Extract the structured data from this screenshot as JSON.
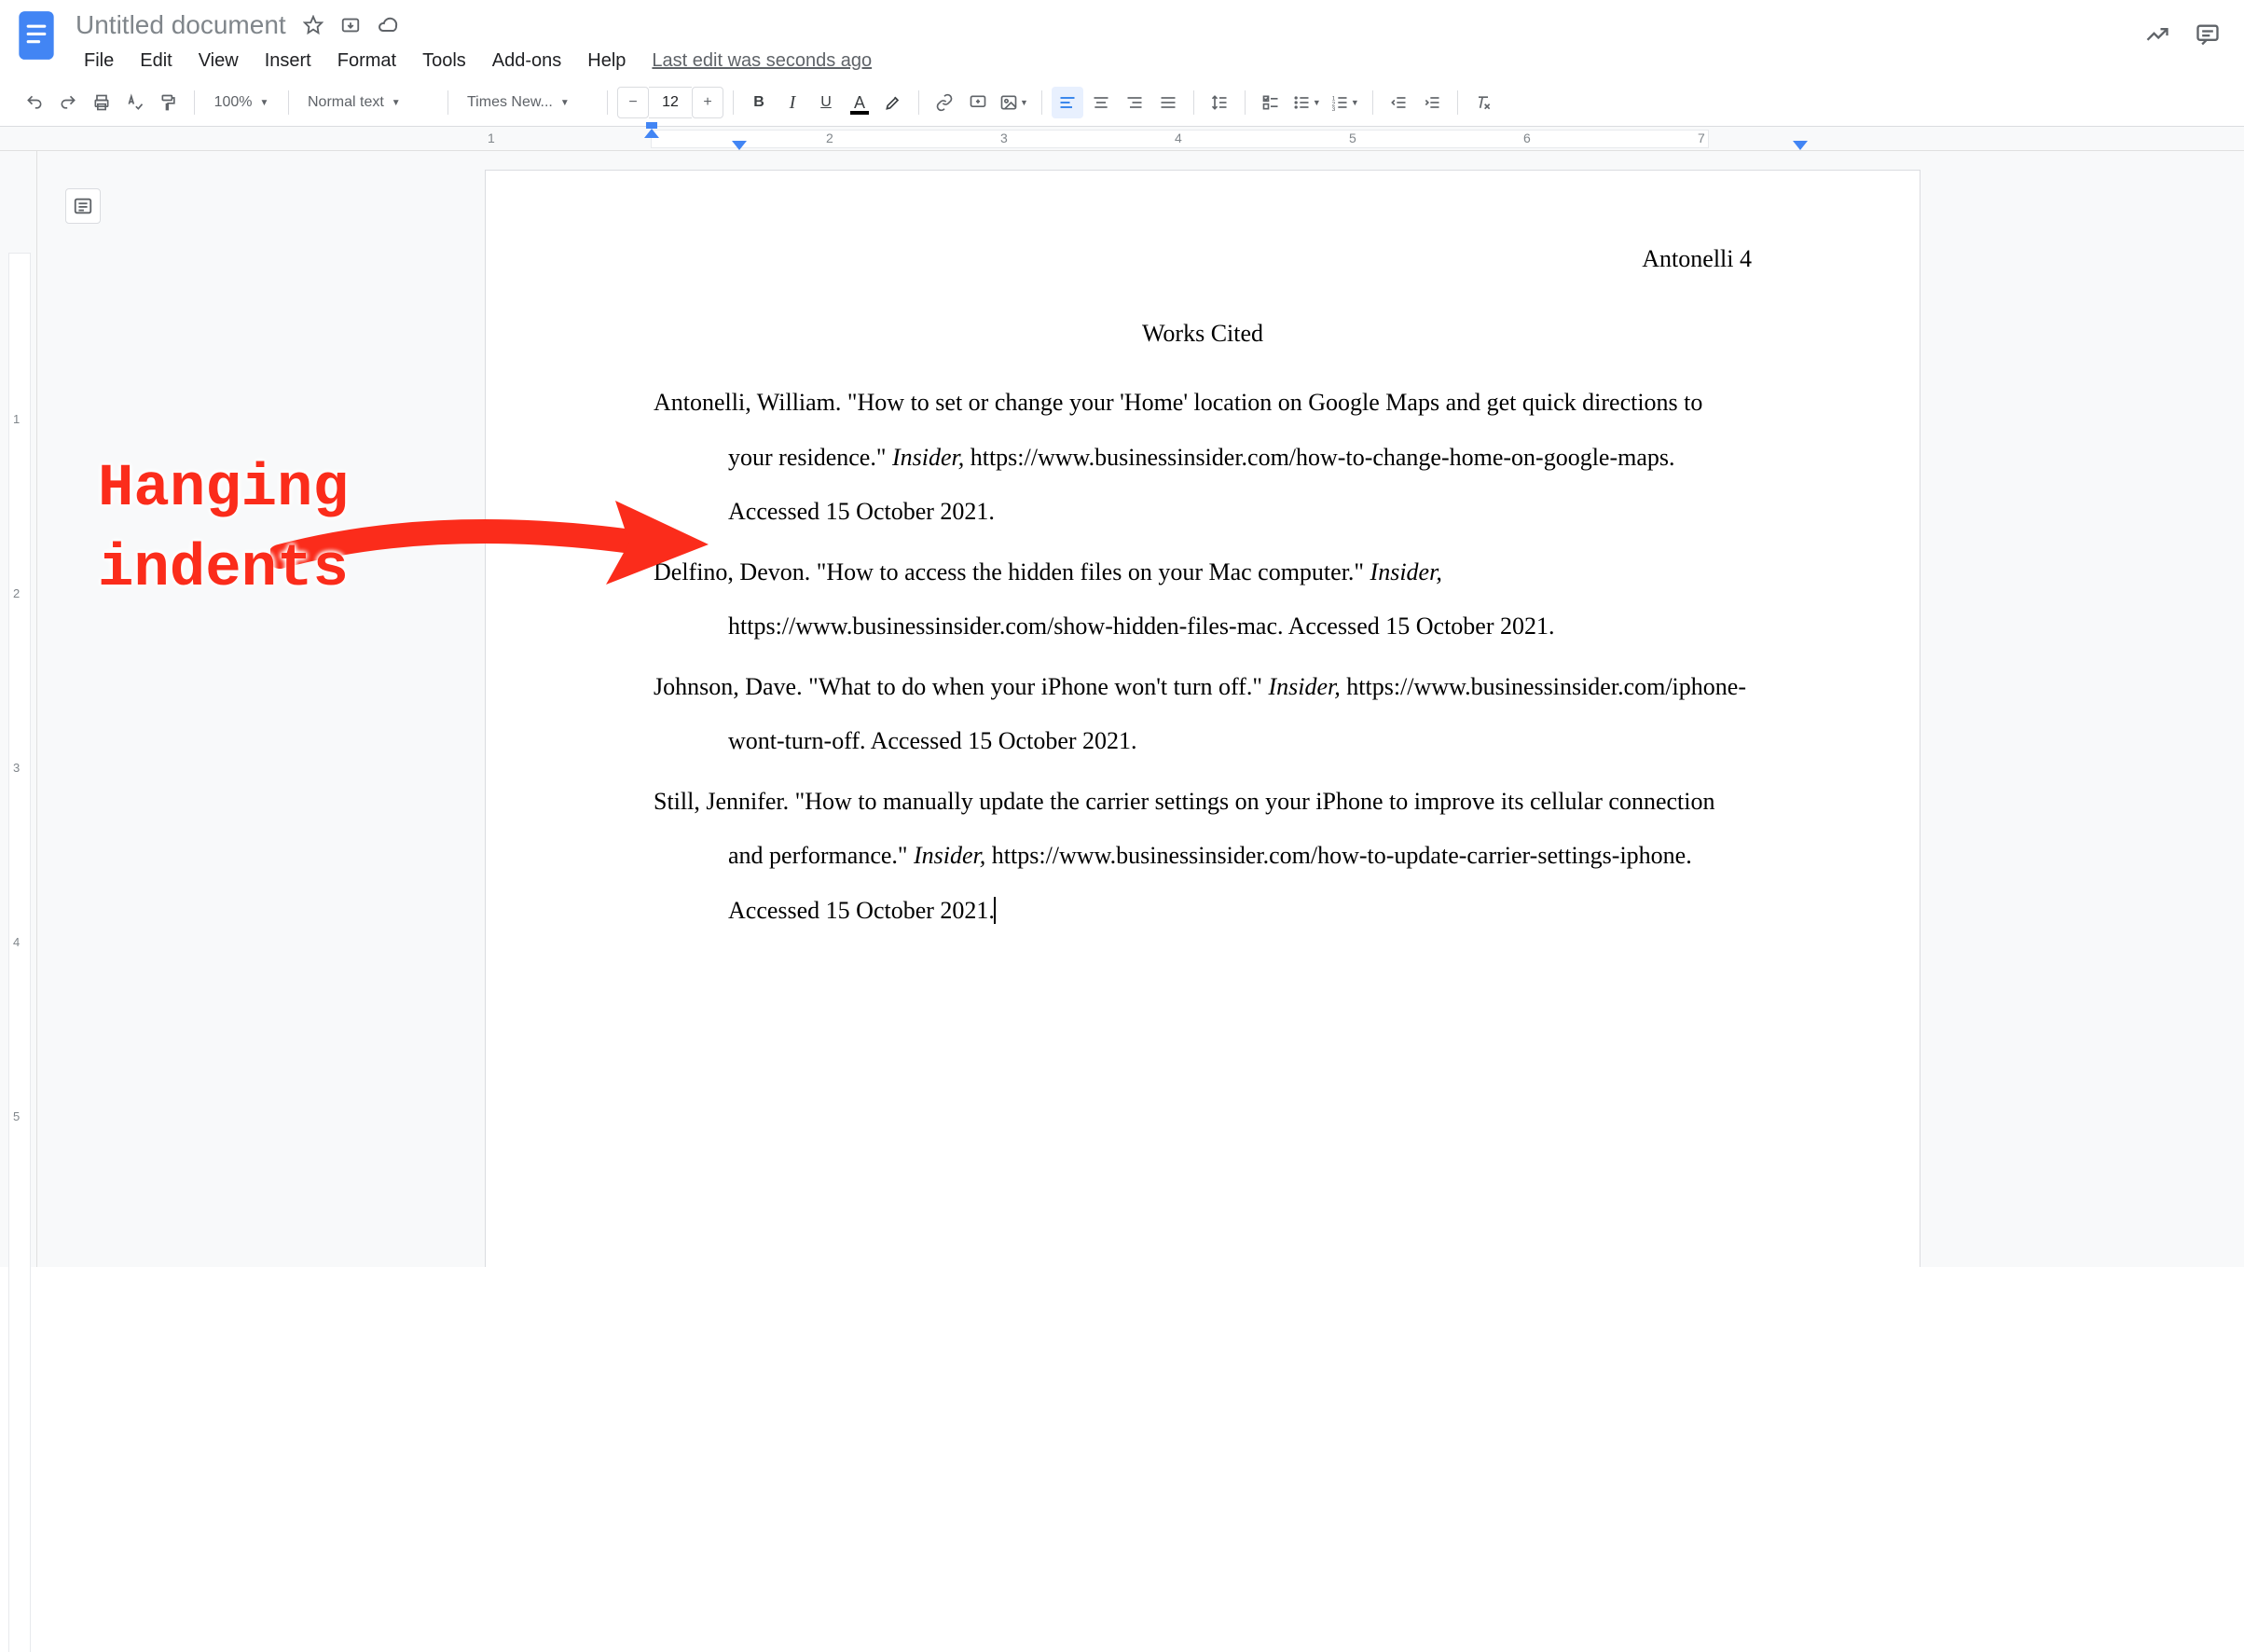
{
  "header": {
    "doc_title": "Untitled document",
    "last_edit": "Last edit was seconds ago"
  },
  "menus": [
    "File",
    "Edit",
    "View",
    "Insert",
    "Format",
    "Tools",
    "Add-ons",
    "Help"
  ],
  "toolbar": {
    "zoom": "100%",
    "style": "Normal text",
    "font": "Times New...",
    "font_size": "12"
  },
  "ruler_numbers": [
    "1",
    "2",
    "3",
    "4",
    "5",
    "6",
    "7"
  ],
  "vruler_numbers": [
    "1",
    "2",
    "3",
    "4",
    "5"
  ],
  "document": {
    "page_header": "Antonelli 4",
    "title": "Works Cited",
    "citations": [
      {
        "a": "Antonelli, William. \"How to set or change your 'Home' location on Google Maps and get quick directions to your residence.\" ",
        "source": "Insider,",
        "b": " https://www.businessinsider.com/how-to-change-home-on-google-maps. Accessed 15 October 2021."
      },
      {
        "a": "Delfino, Devon. \"How to access the hidden files on your Mac computer.\" ",
        "source": "Insider,",
        "b": " https://www.businessinsider.com/show-hidden-files-mac. Accessed 15 October 2021."
      },
      {
        "a": "Johnson, Dave. \"What to do when your iPhone won't turn off.\" ",
        "source": "Insider,",
        "b": " https://www.businessinsider.com/iphone-wont-turn-off. Accessed 15 October 2021."
      },
      {
        "a": "Still, Jennifer. \"How to manually update the carrier settings on your iPhone to improve its cellular connection and performance.\" ",
        "source": "Insider,",
        "b": " https://www.businessinsider.com/how-to-update-carrier-settings-iphone. Accessed 15 October 2021."
      }
    ]
  },
  "annotation": {
    "line1": "Hanging",
    "line2": "indents"
  }
}
